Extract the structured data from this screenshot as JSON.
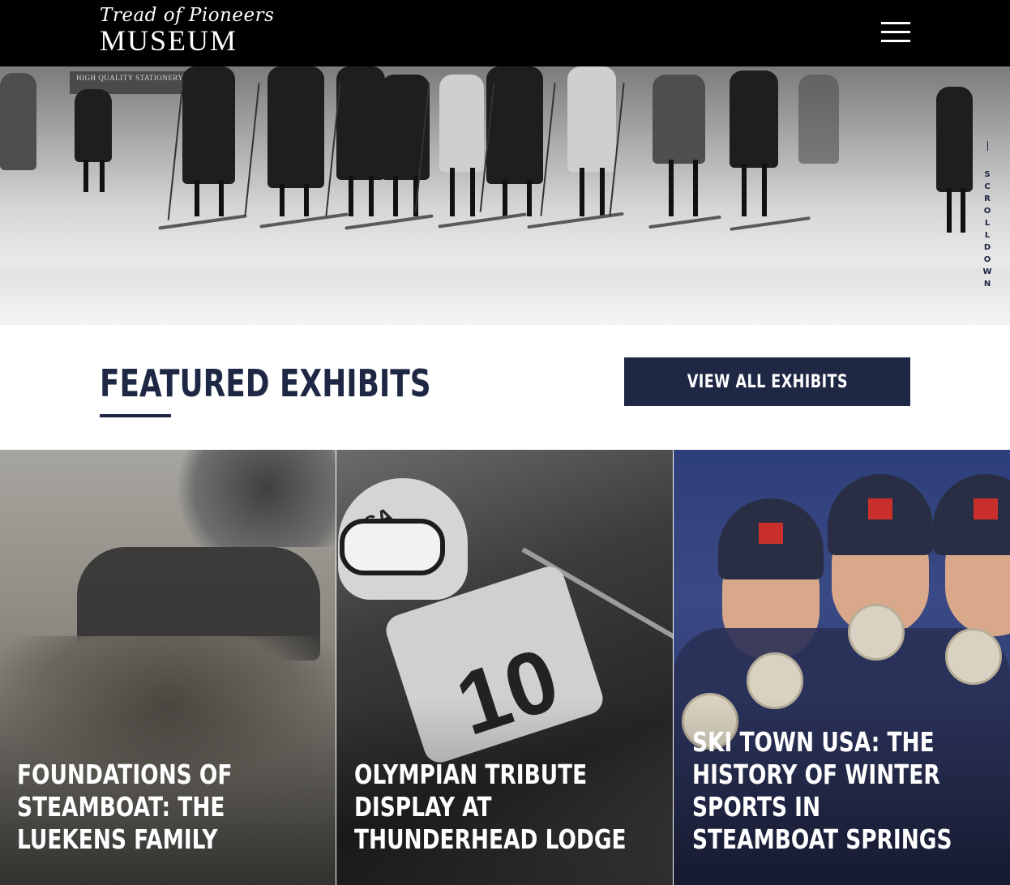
{
  "header": {
    "logo_script": "Tread of Pioneers",
    "logo_word": "MUSEUM"
  },
  "hero": {
    "sign_text": "HIGH QUALITY STATIONERY",
    "scroll_label": "SCROLL DOWN"
  },
  "featured": {
    "title": "FEATURED EXHIBITS",
    "view_all_label": "VIEW ALL EXHIBITS"
  },
  "cards": [
    {
      "title": "FOUNDATIONS OF STEAMBOAT: THE LUEKENS FAMILY"
    },
    {
      "title": "OLYMPIAN TRIBUTE DISPLAY AT THUNDERHEAD LODGE",
      "bib_number": "10",
      "helmet_text": "USA"
    },
    {
      "title": "SKI TOWN USA: THE HISTORY OF WINTER SPORTS IN STEAMBOAT SPRINGS"
    }
  ],
  "colors": {
    "navy": "#1e2744",
    "header_bg": "#000000",
    "white": "#ffffff"
  },
  "icons": {
    "menu": "hamburger-menu-icon"
  }
}
